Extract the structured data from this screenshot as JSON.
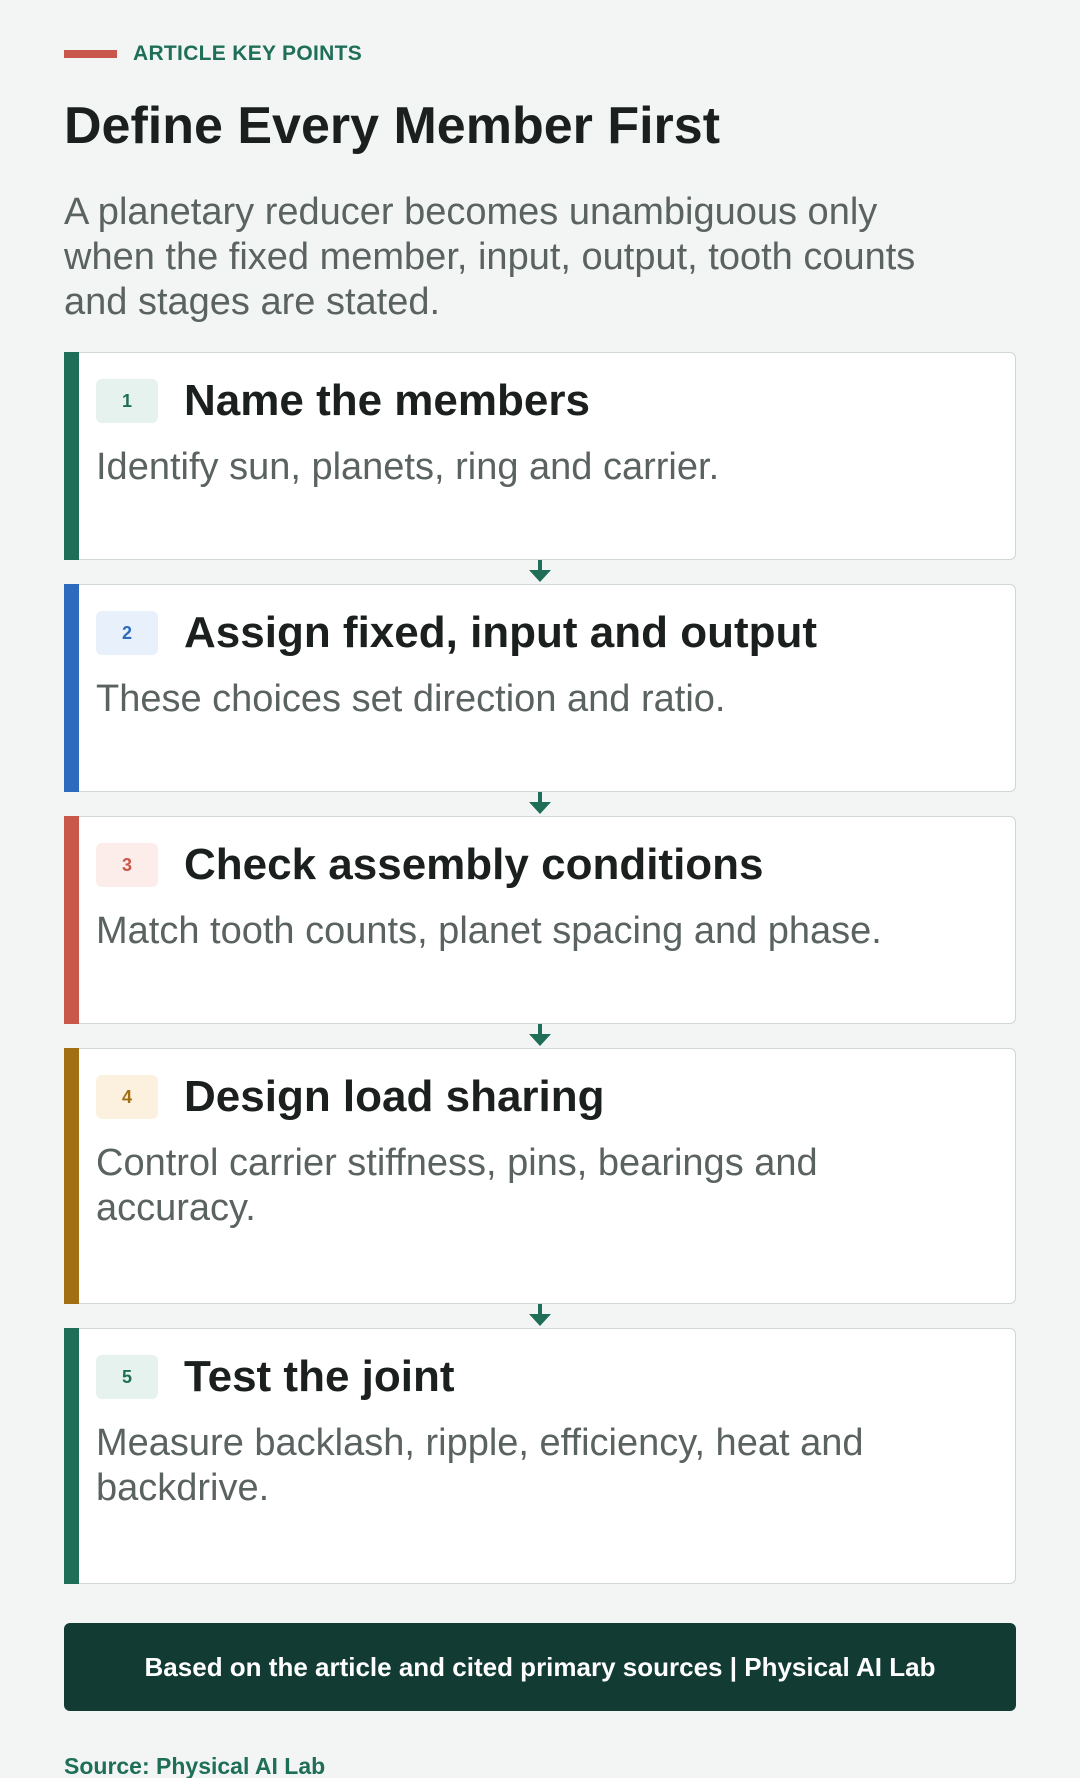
{
  "header": {
    "kicker": "ARTICLE KEY POINTS",
    "title": "Define Every Member First",
    "subtitle": "A planetary reducer becomes unambiguous only when the fixed member, input, output, tooth counts and stages are stated."
  },
  "steps": [
    {
      "number": "1",
      "title": "Name the members",
      "body": "Identify sun, planets, ring and carrier.",
      "accent": "#1e6e58",
      "badge_bg": "#e6f2ee",
      "badge_fg": "#1e6e58"
    },
    {
      "number": "2",
      "title": "Assign fixed, input and output",
      "body": "These choices set direction and ratio.",
      "accent": "#2d6bbf",
      "badge_bg": "#e8f0fb",
      "badge_fg": "#2d6bbf"
    },
    {
      "number": "3",
      "title": "Check assembly conditions",
      "body": "Match tooth counts, planet spacing and phase.",
      "accent": "#c9574a",
      "badge_bg": "#fcecea",
      "badge_fg": "#c9574a"
    },
    {
      "number": "4",
      "title": "Design load sharing",
      "body": "Control carrier stiffness, pins, bearings and accuracy.",
      "accent": "#a26f12",
      "badge_bg": "#fbf1de",
      "badge_fg": "#a26f12"
    },
    {
      "number": "5",
      "title": "Test the joint",
      "body": "Measure backlash, ripple, efficiency, heat and backdrive.",
      "accent": "#1e6e58",
      "badge_bg": "#e6f2ee",
      "badge_fg": "#1e6e58"
    }
  ],
  "footer": {
    "banner": "Based on the article and cited primary sources | Physical AI Lab",
    "source": "Source: Physical AI Lab"
  },
  "colors": {
    "connector": "#1e6e58"
  }
}
